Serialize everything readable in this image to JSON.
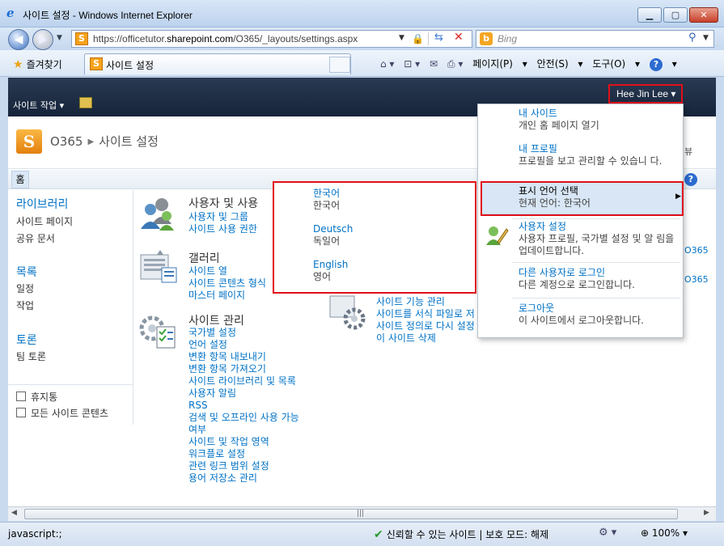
{
  "window": {
    "title": "사이트 설정 - Windows Internet Explorer"
  },
  "address": {
    "url_prefix": "https://officetutor.",
    "url_domain": "sharepoint.com",
    "url_suffix": "/O365/_layouts/settings.aspx",
    "search_placeholder": "Bing"
  },
  "toolbar": {
    "favorites": "즐겨찾기",
    "tab_title": "사이트 설정",
    "page_menu": "페이지(P)",
    "safety_menu": "안전(S)",
    "tools_menu": "도구(O)"
  },
  "ribbon": {
    "site_actions": "사이트 작업",
    "user_name": "Hee Jin Lee"
  },
  "header": {
    "site": "O365",
    "page_title": "사이트 설정"
  },
  "topnav": {
    "home": "홈"
  },
  "leftnav": {
    "libraries_heading": "라이브러리",
    "libraries": [
      "사이트 페이지",
      "공유 문서"
    ],
    "lists_heading": "목록",
    "lists": [
      "일정",
      "작업"
    ],
    "discussions_heading": "토론",
    "discussions": [
      "팀 토론"
    ],
    "recycle_bin": "휴지통",
    "all_content": "모든 사이트 콘텐츠"
  },
  "sections": {
    "users": {
      "title": "사용자 및 사용",
      "links": [
        "사용자 및 그룹",
        "사이트 사용 권한"
      ]
    },
    "galleries": {
      "title": "갤러리",
      "links": [
        "사이트 열",
        "사이트 콘텐츠 형식",
        "마스터 페이지"
      ]
    },
    "site_admin": {
      "title": "사이트 관리",
      "links": [
        "국가별 설정",
        "언어 설정",
        "변환 항목 내보내기",
        "변환 항목 가져오기",
        "사이트 라이브러리 및 목록",
        "사용자 알림",
        "RSS",
        "검색 및 오프라인 사용 가능",
        "여부",
        "사이트 및 작업 영역",
        "워크플로 설정",
        "관련 링크 범위 설정",
        "용어 저장소 관리"
      ]
    },
    "site_actions": {
      "links": [
        "사이트 기능 관리",
        "사이트를 서식 파일로 저",
        "사이트 정의로 다시 설정",
        "이 사이트 삭제"
      ]
    },
    "right_partial": [
      "O365",
      "O365",
      "뷰"
    ]
  },
  "user_menu": [
    {
      "title": "내 사이트",
      "desc": "개인 홈 페이지 열기"
    },
    {
      "title": "내 프로필",
      "desc": "프로필을 보고 관리할 수 있습니 다."
    },
    {
      "title": "표시 언어 선택",
      "desc": "현재 언어: 한국어"
    },
    {
      "title": "사용자 설정",
      "desc": "사용자 프로필, 국가별 설정 및 알 림을 업데이트합니다."
    },
    {
      "title": "다른 사용자로 로그인",
      "desc": "다른 계정으로 로그인합니다."
    },
    {
      "title": "로그아웃",
      "desc": "이 사이트에서 로그아웃합니다."
    }
  ],
  "language_menu": [
    {
      "title": "한국어",
      "desc": "한국어"
    },
    {
      "title": "Deutsch",
      "desc": "독일어"
    },
    {
      "title": "English",
      "desc": "영어"
    }
  ],
  "status": {
    "text": "javascript:;",
    "security": "신뢰할 수 있는 사이트 | 보호 모드: 해제",
    "zoom": "100%"
  }
}
